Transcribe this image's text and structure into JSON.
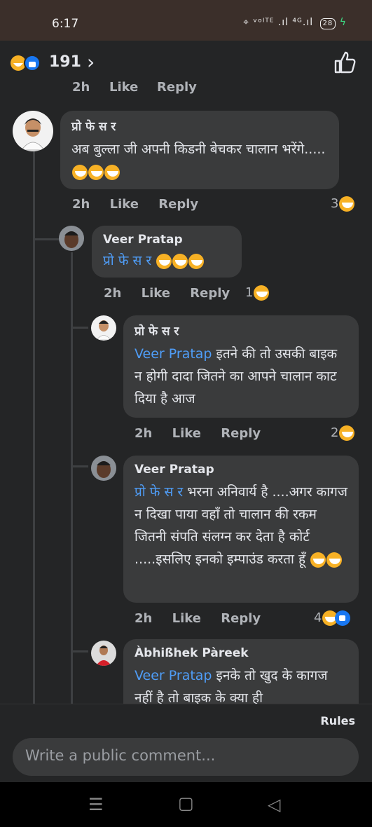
{
  "status": {
    "time": "6:17",
    "icons": "⌖ ᵛᵒˡᵀᴱ .ıl ⁴ᴳ.ıl",
    "battery": "28"
  },
  "header": {
    "reaction_count": "191"
  },
  "truncated_row": {
    "time": "2h",
    "like": "Like",
    "reply": "Reply"
  },
  "comments": [
    {
      "author": "प्रो फे स र",
      "text": "अब बुल्ला जी अपनी किडनी बेचकर चालान भरेंगे.....",
      "time": "2h",
      "like": "Like",
      "reply": "Reply",
      "reactions": "3"
    },
    {
      "author": "Veer Pratap",
      "mention": "प्रो फे स र",
      "text": "",
      "time": "2h",
      "like": "Like",
      "reply": "Reply",
      "reactions": "1"
    },
    {
      "author": "प्रो फे स र",
      "mention": "Veer Pratap",
      "text": " इतने की तो उसकी बाइक न होगी दादा जितने का आपने चालान काट दिया है आज",
      "time": "2h",
      "like": "Like",
      "reply": "Reply",
      "reactions": "2"
    },
    {
      "author": "Veer Pratap",
      "mention": "प्रो फे स र",
      "text": " भरना अनिवार्य है ....अगर कागज न दिखा पाया वहाँ तो चालान की रकम जितनी संपति संलग्न कर देता है कोर्ट .....इसलिए इनको इम्पाउंड करता हूँ",
      "time": "2h",
      "like": "Like",
      "reply": "Reply",
      "reactions": "4"
    },
    {
      "author": "Àbhißhek Pàreek",
      "mention": "Veer Pratap",
      "text": " इनके तो खुद के कागज नहीं है तो बाइक के क्या ही"
    }
  ],
  "footer": {
    "rules": "Rules",
    "input_placeholder": "Write a public comment..."
  },
  "colors": {
    "background": "#242526",
    "bubble": "#3a3b3c",
    "mention": "#4f9df7",
    "like_blue": "#1877f2",
    "emoji": "#f7b125"
  },
  "icons": [
    "haha-reaction-icon",
    "like-reaction-icon",
    "chevron-right-icon",
    "thumbs-up-icon",
    "menu-icon",
    "home-icon",
    "back-icon"
  ]
}
